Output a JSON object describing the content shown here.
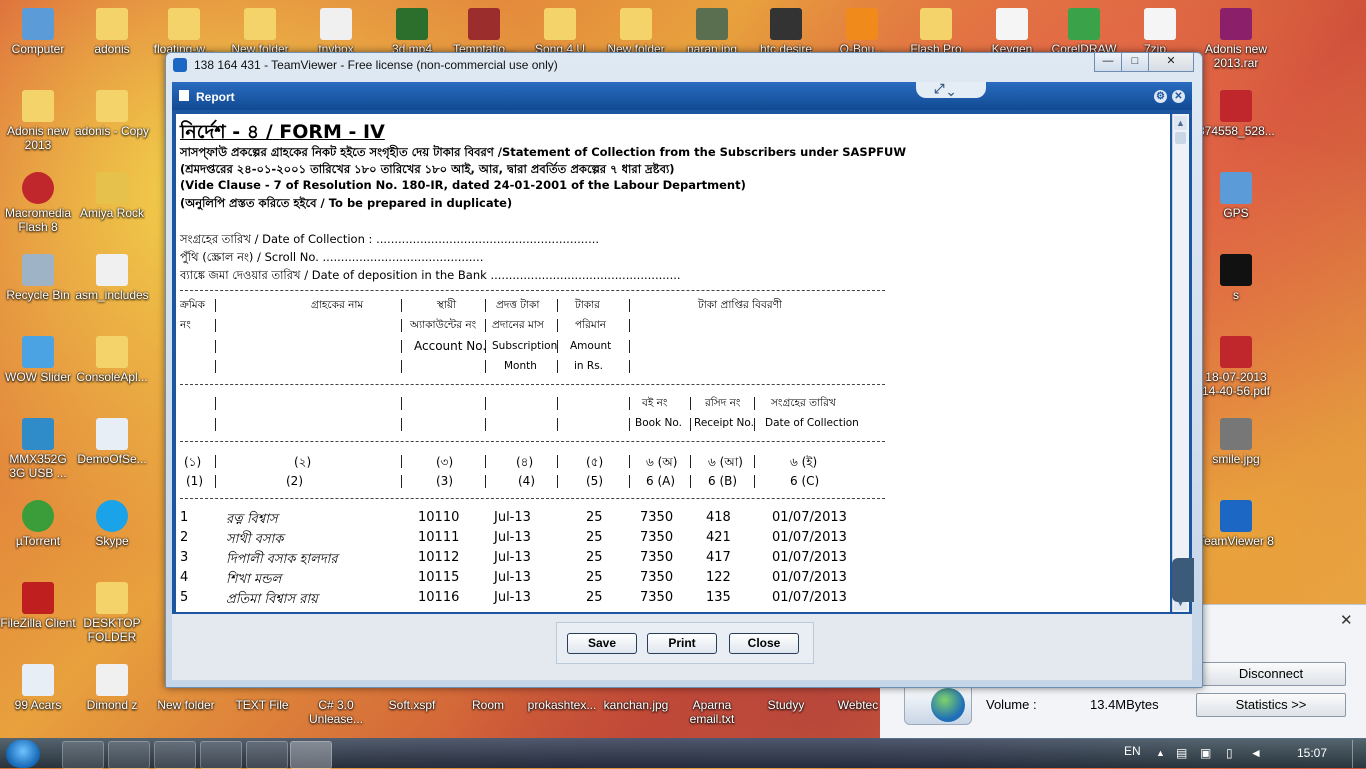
{
  "desktop": {
    "icons_left": [
      {
        "label": "Computer",
        "x": 0
      },
      {
        "label": "Adonis new 2013"
      },
      {
        "label": "Macromedia Flash 8"
      },
      {
        "label": "Recycle Bin"
      },
      {
        "label": "WOW Slider"
      },
      {
        "label": "MMX352G 3G USB ..."
      },
      {
        "label": "µTorrent"
      },
      {
        "label": "FileZilla Client"
      },
      {
        "label": "99 Acars"
      }
    ],
    "icons_col2": [
      "adonis",
      "adonis - Copy",
      "Amiya Rock",
      "asm_includes",
      "ConsoleApl...",
      "DemoOfSe...",
      "Skype",
      "DESKTOP FOLDER",
      "Dimond z"
    ],
    "icons_top": [
      "floating-w...",
      "New folder",
      "tnvbox",
      "3d.mp4",
      "Temptatio...",
      "Song 4 U",
      "New folder",
      "naran.jpg",
      "htc desire",
      "Q-Bou...",
      "Flash Pro CS6",
      "Keygen",
      "CorelDRAW",
      "7zip...",
      "Adonis new 2013.rar"
    ],
    "icons_right": [
      "374558_528...",
      "GPS",
      "s",
      "18-07-2013 14-40-56.pdf",
      "smile.jpg",
      "TeamViewer 8"
    ],
    "icons_bottom": [
      "New folder",
      "TEXT File",
      "C# 3.0 Unlease...",
      "Soft.xspf",
      "Room",
      "prokashtex...",
      "kanchan.jpg",
      "Aparna email.txt",
      "Studyy",
      "Webtec"
    ]
  },
  "teamviewer": {
    "title": "138 164 431 - TeamViewer - Free license (non-commercial use only)",
    "minimize": "—",
    "maximize": "□",
    "close": "✕"
  },
  "report": {
    "title": "Report",
    "tab_icons": "⤢ ⌄",
    "form_title_bn": "নির্দেশ - ৪ /",
    "form_title_en": "FORM - IV",
    "line1_bn": "সাসপ্ফাউ প্রকল্পের গ্রাহকের নিকট হইতে সংগৃহীত দেয় টাকার বিবরণ",
    "line1_en": "/Statement of Collection from the Subscribers under SASPFUW",
    "line2": "(শ্রমদপ্তরের ২৪-০১-২০০১ তারিখের ১৮০ তারিখের ১৮০ আই, আর, দ্বারা প্রবর্তিত প্রকল্পের ৭ ধারা দ্রষ্টব্য)",
    "line3": "(Vide Clause - 7 of Resolution No. 180-IR, dated 24-01-2001 of the Labour Department)",
    "line4_bn": "(অনুলিপি প্রস্তত করিতে হইবে /",
    "line4_en": "To be prepared in duplicate)",
    "date_collection": "সংগ্রহের তারিখ / Date of Collection : .............................................................",
    "scroll_no": "পুঁথি (স্ক্রোল নং) / Scroll No. ............................................",
    "date_deposition": "ব্যাঙ্কে জমা দেওয়ার তারিখ / Date of deposition in the Bank ....................................................",
    "headers": {
      "serial_bn": "ক্রমিক",
      "serial_bn2": "নং",
      "name_bn": "গ্রাহকের নাম",
      "account_bn": "স্থায়ী",
      "account_bn2": "অ্যাকাউন্টের নং",
      "account_en": "Account No.",
      "sub_bn": "প্রদত্ত টাকা",
      "sub_bn2": "প্রদানের মাস",
      "sub_en": "Subscription",
      "sub_en2": "Month",
      "amount_bn": "টাকার",
      "amount_bn2": "পরিমান",
      "amount_en": "Amount",
      "amount_en2": "in Rs.",
      "receipt_bn": "টাকা প্রাপ্তির বিবরণী",
      "book_bn": "বই নং",
      "book_en": "Book No.",
      "receiptno_bn": "রসিদ নং",
      "receiptno_en": "Receipt No.",
      "coll_bn": "সংগ্রহের তারিখ",
      "coll_en": "Date of Collection"
    },
    "col_numbers_bn": [
      "(১)",
      "(২)",
      "(৩)",
      "(৪)",
      "(৫)",
      "৬ (অ)",
      "৬ (আ)",
      "৬ (ই)"
    ],
    "col_numbers_en": [
      "(1)",
      "(2)",
      "(3)",
      "(4)",
      "(5)",
      "6 (A)",
      "6 (B)",
      "6 (C)"
    ],
    "rows": [
      [
        "1",
        "রত্ন বিশ্বাস",
        "10110",
        "Jul-13",
        "25",
        "7350",
        "418",
        "01/07/2013"
      ],
      [
        "2",
        "সাথী বসাক",
        "10111",
        "Jul-13",
        "25",
        "7350",
        "421",
        "01/07/2013"
      ],
      [
        "3",
        "দিপালী বসাক হালদার",
        "10112",
        "Jul-13",
        "25",
        "7350",
        "417",
        "01/07/2013"
      ],
      [
        "4",
        "শিখা মন্ডল",
        "10115",
        "Jul-13",
        "25",
        "7350",
        "122",
        "01/07/2013"
      ],
      [
        "5",
        "প্রতিমা বিশ্বাস রায়",
        "10116",
        "Jul-13",
        "25",
        "7350",
        "135",
        "01/07/2013"
      ]
    ],
    "buttons": {
      "save": "Save",
      "print": "Print",
      "close": "Close"
    }
  },
  "side_panel": {
    "close": "✕",
    "disconnect": "Disconnect",
    "volume_label": "Volume :",
    "volume_value": "13.4MBytes",
    "statistics": "Statistics   >>"
  },
  "taskbar": {
    "lang": "EN",
    "time": "15:07"
  }
}
